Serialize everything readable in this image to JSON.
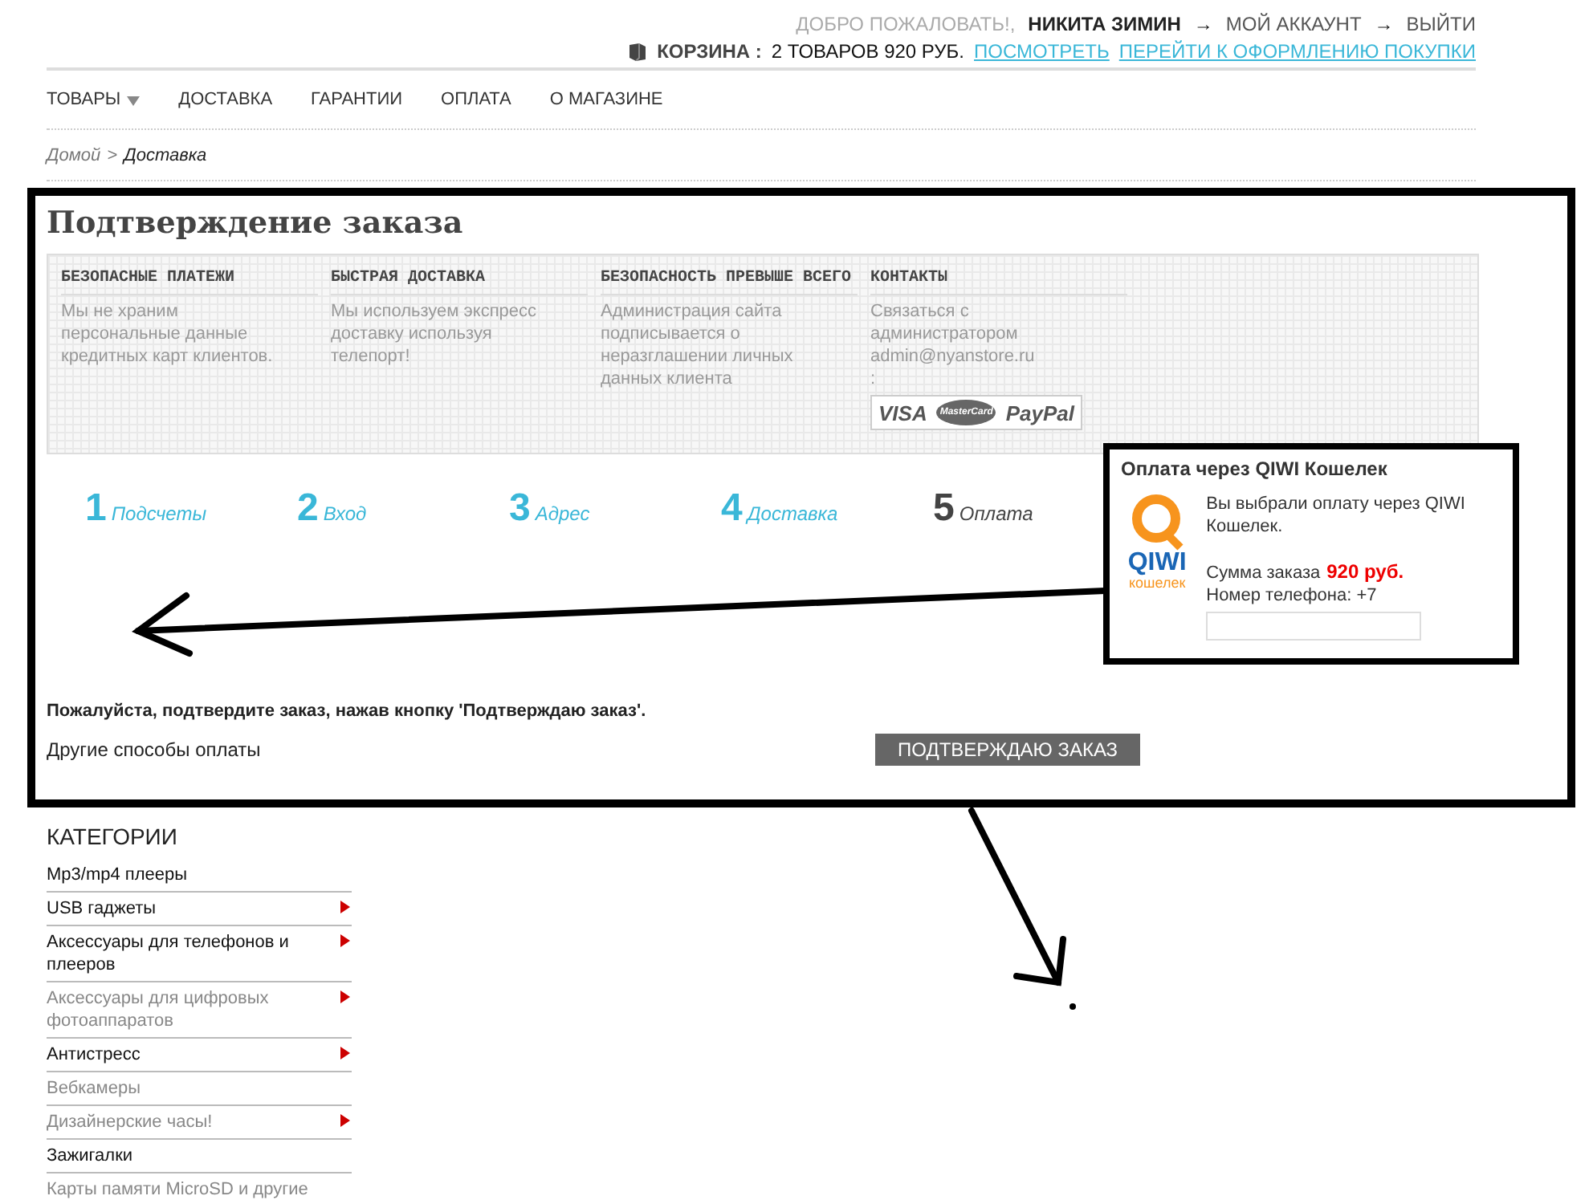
{
  "header": {
    "welcome": "ДОБРО ПОЖАЛОВАТЬ!,",
    "user": "НИКИТА ЗИМИН",
    "arrow": "→",
    "account": "МОЙ АККАУНТ",
    "arrow2": "→",
    "logout": "ВЫЙТИ",
    "cart_label": "КОРЗИНА :",
    "cart_summary": "2 ТОВАРОВ 920 РУБ.",
    "links": [
      "ПОСМОТРЕТЬ",
      "ПЕРЕЙТИ К ОФОРМЛЕНИЮ ПОКУПКИ"
    ]
  },
  "nav": [
    {
      "label": "ТОВАРЫ",
      "has_dropdown": true
    },
    {
      "label": "ДОСТАВКА",
      "has_dropdown": false
    },
    {
      "label": "ГАРАНТИИ",
      "has_dropdown": false
    },
    {
      "label": "ОПЛАТА",
      "has_dropdown": false
    },
    {
      "label": "О МАГАЗИНЕ",
      "has_dropdown": false
    }
  ],
  "breadcrumb": {
    "home": "Домой",
    "separator": ">",
    "current": "Доставка"
  },
  "page_title": "Подтверждение заказа",
  "features": [
    {
      "title": "БЕЗОПАСНЫЕ ПЛАТЕЖИ",
      "text": "Мы не храним персональные данные кредитных карт клиентов."
    },
    {
      "title": "БЫСТРАЯ ДОСТАВКА",
      "text": "Мы используем экспресс доставку используя телепорт!"
    },
    {
      "title": "БЕЗОПАСНОСТЬ ПРЕВЫШЕ ВСЕГО",
      "text": "Администрация сайта подписывается о неразглашении личных данных клиента"
    },
    {
      "title": "КОНТАКТЫ",
      "text": "Связаться с администратором admin@nyanstore.ru",
      "extra": ":",
      "payment_logos": [
        "VISA",
        "MasterCard",
        "PayPal"
      ]
    }
  ],
  "steps": [
    {
      "number": "1",
      "label": "Подсчеты",
      "selected": false
    },
    {
      "number": "2",
      "label": "Вход",
      "selected": false
    },
    {
      "number": "3",
      "label": "Адрес",
      "selected": false
    },
    {
      "number": "4",
      "label": "Доставка",
      "selected": false
    },
    {
      "number": "5",
      "label": "Оплата",
      "selected": true
    }
  ],
  "qiwi": {
    "title": "Оплата через QIWI Кошелек",
    "logo_brand": "QIWI",
    "logo_caption": "кошелек",
    "message": "Вы выбрали оплату через QIWI Кошелек.",
    "sum_label": "Сумма заказа",
    "sum": "920 руб.",
    "phone_label": "Номер телефона: +7"
  },
  "confirm_note": "Пожалуйста, подтвердите заказ, нажав кнопку 'Подтверждаю заказ'.",
  "other_methods": "Другие способы оплаты",
  "confirm_button": "ПОДТВЕРЖДАЮ ЗАКАЗ",
  "categories": {
    "title": "КАТЕГОРИИ",
    "items": [
      {
        "label": "Mp3/mp4 плееры",
        "visited": false,
        "has_submenu": false
      },
      {
        "label": "USB гаджеты",
        "visited": false,
        "has_submenu": true
      },
      {
        "label": "Аксессуары для телефонов и плееров",
        "visited": false,
        "has_submenu": true
      },
      {
        "label": "Аксессуары для цифровых фотоаппаратов",
        "visited": true,
        "has_submenu": true
      },
      {
        "label": "Антистресс",
        "visited": false,
        "has_submenu": true
      },
      {
        "label": "Вебкамеры",
        "visited": true,
        "has_submenu": false
      },
      {
        "label": "Дизайнерские часы!",
        "visited": true,
        "has_submenu": true
      },
      {
        "label": "Зажигалки",
        "visited": false,
        "has_submenu": false
      },
      {
        "label": "Карты памяти MicroSD и другие",
        "visited": true,
        "has_submenu": false
      }
    ]
  }
}
